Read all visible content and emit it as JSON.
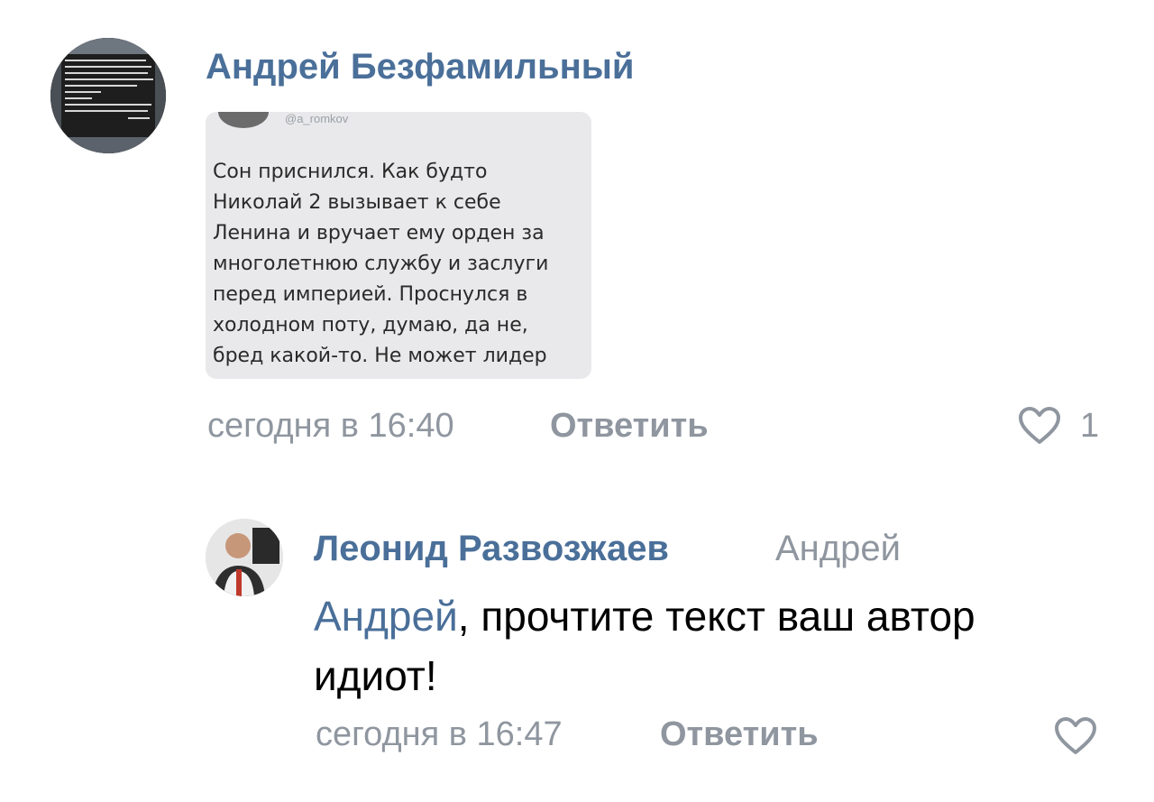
{
  "comments": [
    {
      "author": "Андрей Безфамильный",
      "attachment": {
        "handle": "@a_romkov",
        "text": "Сон приснился. Как будто\nНиколай 2 вызывает к себе\nЛенина и вручает ему орден за\nмноголетнюю службу и заслуги\nперед империей. Проснулся в\nхолодном поту, думаю, да не,\nбред какой-то. Не может лидер"
      },
      "time": "сегодня в 16:40",
      "reply_label": "Ответить",
      "likes": "1"
    },
    {
      "author": "Леонид Развозжаев",
      "reply_to": "Андрей",
      "mention": "Андрей",
      "text": ", прочтите текст ваш автор идиот!",
      "time": "сегодня в 16:47",
      "reply_label": "Ответить",
      "likes": ""
    }
  ],
  "colors": {
    "author": "#4a6f99",
    "muted": "#8f969f",
    "text": "#000000"
  },
  "icons": {
    "like": "heart-outline-icon"
  }
}
